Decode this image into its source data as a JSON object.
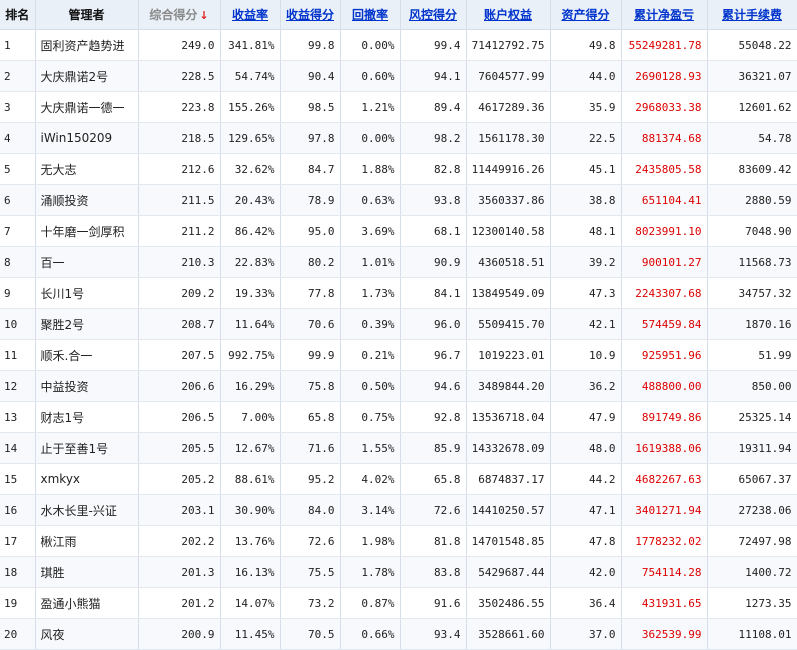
{
  "colors": {
    "header_bg": "#e9f0f8",
    "link": "#0033cc",
    "profit": "#dd0000",
    "sort_arrow": "#e02020",
    "grid": "#d6dfe9"
  },
  "headers": {
    "rank": "排名",
    "manager": "管理者",
    "composite": "综合得分",
    "composite_arrow": "↓",
    "return_rate": "收益率",
    "return_score": "收益得分",
    "drawdown": "回撤率",
    "risk_score": "风控得分",
    "equity": "账户权益",
    "asset_score": "资产得分",
    "net_profit": "累计净盈亏",
    "fees": "累计手续费"
  },
  "rows": [
    {
      "rank": "1",
      "name": "固利资产趋势进",
      "composite": "249.0",
      "return_rate": "341.81%",
      "return_score": "99.8",
      "drawdown": "0.00%",
      "risk_score": "99.4",
      "equity": "71412792.75",
      "asset_score": "49.8",
      "net_profit": "55249281.78",
      "fees": "55048.22"
    },
    {
      "rank": "2",
      "name": "大庆鼎诺2号",
      "composite": "228.5",
      "return_rate": "54.74%",
      "return_score": "90.4",
      "drawdown": "0.60%",
      "risk_score": "94.1",
      "equity": "7604577.99",
      "asset_score": "44.0",
      "net_profit": "2690128.93",
      "fees": "36321.07"
    },
    {
      "rank": "3",
      "name": "大庆鼎诺一德一",
      "composite": "223.8",
      "return_rate": "155.26%",
      "return_score": "98.5",
      "drawdown": "1.21%",
      "risk_score": "89.4",
      "equity": "4617289.36",
      "asset_score": "35.9",
      "net_profit": "2968033.38",
      "fees": "12601.62"
    },
    {
      "rank": "4",
      "name": "iWin150209",
      "composite": "218.5",
      "return_rate": "129.65%",
      "return_score": "97.8",
      "drawdown": "0.00%",
      "risk_score": "98.2",
      "equity": "1561178.30",
      "asset_score": "22.5",
      "net_profit": "881374.68",
      "fees": "54.78"
    },
    {
      "rank": "5",
      "name": "无大志",
      "composite": "212.6",
      "return_rate": "32.62%",
      "return_score": "84.7",
      "drawdown": "1.88%",
      "risk_score": "82.8",
      "equity": "11449916.26",
      "asset_score": "45.1",
      "net_profit": "2435805.58",
      "fees": "83609.42"
    },
    {
      "rank": "6",
      "name": "涌顺投资",
      "composite": "211.5",
      "return_rate": "20.43%",
      "return_score": "78.9",
      "drawdown": "0.63%",
      "risk_score": "93.8",
      "equity": "3560337.86",
      "asset_score": "38.8",
      "net_profit": "651104.41",
      "fees": "2880.59"
    },
    {
      "rank": "7",
      "name": "十年磨一剑厚积",
      "composite": "211.2",
      "return_rate": "86.42%",
      "return_score": "95.0",
      "drawdown": "3.69%",
      "risk_score": "68.1",
      "equity": "12300140.58",
      "asset_score": "48.1",
      "net_profit": "8023991.10",
      "fees": "7048.90"
    },
    {
      "rank": "8",
      "name": "百一",
      "composite": "210.3",
      "return_rate": "22.83%",
      "return_score": "80.2",
      "drawdown": "1.01%",
      "risk_score": "90.9",
      "equity": "4360518.51",
      "asset_score": "39.2",
      "net_profit": "900101.27",
      "fees": "11568.73"
    },
    {
      "rank": "9",
      "name": "长川1号",
      "composite": "209.2",
      "return_rate": "19.33%",
      "return_score": "77.8",
      "drawdown": "1.73%",
      "risk_score": "84.1",
      "equity": "13849549.09",
      "asset_score": "47.3",
      "net_profit": "2243307.68",
      "fees": "34757.32"
    },
    {
      "rank": "10",
      "name": "聚胜2号",
      "composite": "208.7",
      "return_rate": "11.64%",
      "return_score": "70.6",
      "drawdown": "0.39%",
      "risk_score": "96.0",
      "equity": "5509415.70",
      "asset_score": "42.1",
      "net_profit": "574459.84",
      "fees": "1870.16"
    },
    {
      "rank": "11",
      "name": "顺禾.合一",
      "composite": "207.5",
      "return_rate": "992.75%",
      "return_score": "99.9",
      "drawdown": "0.21%",
      "risk_score": "96.7",
      "equity": "1019223.01",
      "asset_score": "10.9",
      "net_profit": "925951.96",
      "fees": "51.99"
    },
    {
      "rank": "12",
      "name": "中益投资",
      "composite": "206.6",
      "return_rate": "16.29%",
      "return_score": "75.8",
      "drawdown": "0.50%",
      "risk_score": "94.6",
      "equity": "3489844.20",
      "asset_score": "36.2",
      "net_profit": "488800.00",
      "fees": "850.00"
    },
    {
      "rank": "13",
      "name": "财志1号",
      "composite": "206.5",
      "return_rate": "7.00%",
      "return_score": "65.8",
      "drawdown": "0.75%",
      "risk_score": "92.8",
      "equity": "13536718.04",
      "asset_score": "47.9",
      "net_profit": "891749.86",
      "fees": "25325.14"
    },
    {
      "rank": "14",
      "name": "止于至善1号",
      "composite": "205.5",
      "return_rate": "12.67%",
      "return_score": "71.6",
      "drawdown": "1.55%",
      "risk_score": "85.9",
      "equity": "14332678.09",
      "asset_score": "48.0",
      "net_profit": "1619388.06",
      "fees": "19311.94"
    },
    {
      "rank": "15",
      "name": "xmkyx",
      "composite": "205.2",
      "return_rate": "88.61%",
      "return_score": "95.2",
      "drawdown": "4.02%",
      "risk_score": "65.8",
      "equity": "6874837.17",
      "asset_score": "44.2",
      "net_profit": "4682267.63",
      "fees": "65067.37"
    },
    {
      "rank": "16",
      "name": "水木长里-兴证",
      "composite": "203.1",
      "return_rate": "30.90%",
      "return_score": "84.0",
      "drawdown": "3.14%",
      "risk_score": "72.6",
      "equity": "14410250.57",
      "asset_score": "47.1",
      "net_profit": "3401271.94",
      "fees": "27238.06"
    },
    {
      "rank": "17",
      "name": "楸江雨",
      "composite": "202.2",
      "return_rate": "13.76%",
      "return_score": "72.6",
      "drawdown": "1.98%",
      "risk_score": "81.8",
      "equity": "14701548.85",
      "asset_score": "47.8",
      "net_profit": "1778232.02",
      "fees": "72497.98"
    },
    {
      "rank": "18",
      "name": "琪胜",
      "composite": "201.3",
      "return_rate": "16.13%",
      "return_score": "75.5",
      "drawdown": "1.78%",
      "risk_score": "83.8",
      "equity": "5429687.44",
      "asset_score": "42.0",
      "net_profit": "754114.28",
      "fees": "1400.72"
    },
    {
      "rank": "19",
      "name": "盈通小熊猫",
      "composite": "201.2",
      "return_rate": "14.07%",
      "return_score": "73.2",
      "drawdown": "0.87%",
      "risk_score": "91.6",
      "equity": "3502486.55",
      "asset_score": "36.4",
      "net_profit": "431931.65",
      "fees": "1273.35"
    },
    {
      "rank": "20",
      "name": "风夜",
      "composite": "200.9",
      "return_rate": "11.45%",
      "return_score": "70.5",
      "drawdown": "0.66%",
      "risk_score": "93.4",
      "equity": "3528661.60",
      "asset_score": "37.0",
      "net_profit": "362539.99",
      "fees": "11108.01"
    }
  ]
}
